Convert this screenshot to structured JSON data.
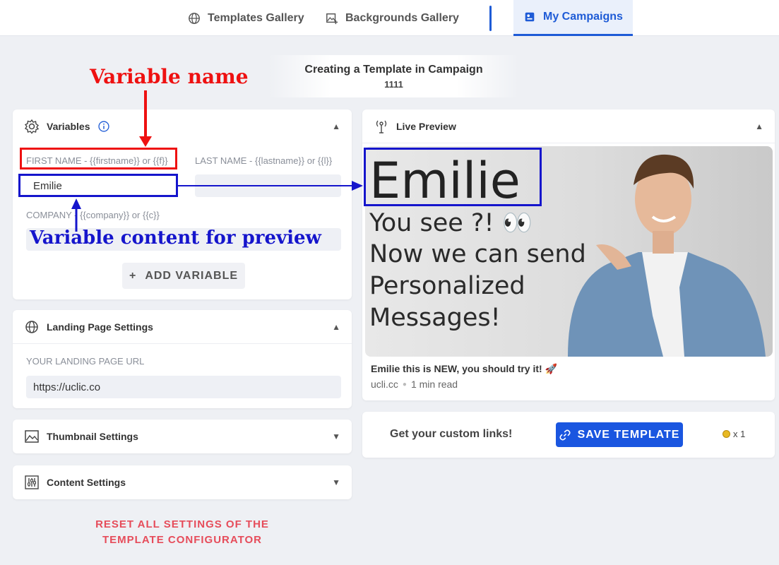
{
  "nav": {
    "templates_gallery": "Templates Gallery",
    "backgrounds_gallery": "Backgrounds Gallery",
    "my_campaigns": "My Campaigns"
  },
  "campaign": {
    "heading": "Creating a Template in Campaign",
    "id": "1111"
  },
  "variables": {
    "title": "Variables",
    "first_name_label": "FIRST NAME - {{firstname}} or {{f}}",
    "first_name_value": "Emilie",
    "last_name_label": "LAST NAME - {{lastname}} or {{l}}",
    "last_name_value": "",
    "company_label": "COMPANY - {{company}} or {{c}}",
    "company_value": "",
    "add_variable": "ADD VARIABLE"
  },
  "landing": {
    "title": "Landing Page Settings",
    "url_label": "YOUR LANDING PAGE URL",
    "url_value": "https://uclic.co"
  },
  "thumbnail": {
    "title": "Thumbnail Settings"
  },
  "content": {
    "title": "Content Settings"
  },
  "reset": {
    "line1": "RESET ALL SETTINGS OF THE",
    "line2": "TEMPLATE CONFIGURATOR"
  },
  "preview": {
    "title": "Live Preview",
    "name": "Emilie",
    "line1": "You see ?! 👀",
    "line2": "Now we can send",
    "line3": "Personalized",
    "line4": "Messages!",
    "link_title": "Emilie this is NEW, you should try it! 🚀",
    "domain": "ucli.cc",
    "read_time": "1 min read"
  },
  "save_bar": {
    "text": "Get your custom links!",
    "button": "SAVE TEMPLATE",
    "credit": "x 1"
  },
  "annotations": {
    "variable_name": "Variable name",
    "variable_content": "Variable content for preview"
  },
  "colors": {
    "accent": "#1a56e0",
    "annotation_red": "#ee1111",
    "annotation_blue": "#1515cc",
    "reset_red": "#e64c5a"
  }
}
